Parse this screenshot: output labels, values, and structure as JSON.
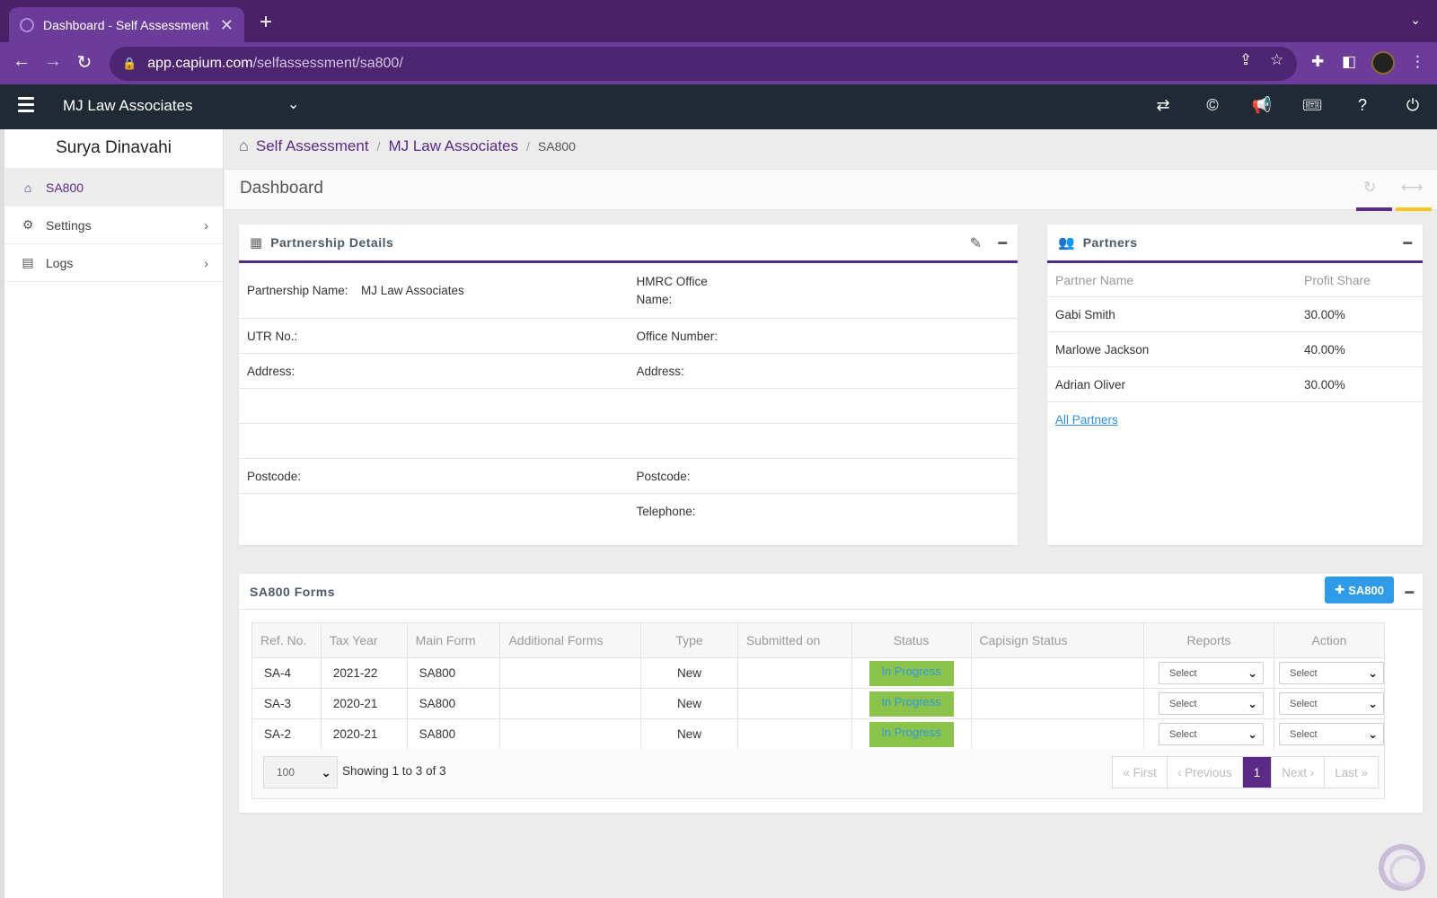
{
  "browser": {
    "tab_title": "Dashboard - Self Assessment",
    "url_host": "app.capium.com",
    "url_path": "/selfassessment/sa800/"
  },
  "header": {
    "client_name": "MJ Law Associates"
  },
  "sidebar": {
    "user_name": "Surya Dinavahi",
    "items": [
      {
        "label": "SA800"
      },
      {
        "label": "Settings"
      },
      {
        "label": "Logs"
      }
    ]
  },
  "breadcrumb": {
    "items": [
      "Self Assessment",
      "MJ Law Associates"
    ],
    "current": "SA800"
  },
  "page": {
    "title": "Dashboard"
  },
  "partnership": {
    "title": "Partnership Details",
    "name_label": "Partnership Name:",
    "name_value": "MJ Law Associates",
    "hmrc_label": "HMRC Office Name:",
    "utr_label": "UTR No.:",
    "office_number_label": "Office Number:",
    "address_label": "Address:",
    "office_address_label": "Address:",
    "postcode_label": "Postcode:",
    "office_postcode_label": "Postcode:",
    "telephone_label": "Telephone:"
  },
  "partners": {
    "title": "Partners",
    "col_name": "Partner Name",
    "col_share": "Profit Share",
    "rows": [
      {
        "name": "Gabi Smith",
        "share": "30.00%"
      },
      {
        "name": "Marlowe Jackson",
        "share": "40.00%"
      },
      {
        "name": "Adrian Oliver",
        "share": "30.00%"
      }
    ],
    "all_link": "All Partners"
  },
  "forms": {
    "title": "SA800 Forms",
    "add_label": "SA800",
    "columns": [
      "Ref. No.",
      "Tax Year",
      "Main Form",
      "Additional Forms",
      "Type",
      "Submitted on",
      "Status",
      "Capisign Status",
      "Reports",
      "Action"
    ],
    "rows": [
      {
        "ref": "SA-4",
        "year": "2021-22",
        "main": "SA800",
        "additional": "",
        "type": "New",
        "submitted": "",
        "status": "In Progress",
        "capisign": "",
        "reports": "Select",
        "action": "Select"
      },
      {
        "ref": "SA-3",
        "year": "2020-21",
        "main": "SA800",
        "additional": "",
        "type": "New",
        "submitted": "",
        "status": "In Progress",
        "capisign": "",
        "reports": "Select",
        "action": "Select"
      },
      {
        "ref": "SA-2",
        "year": "2020-21",
        "main": "SA800",
        "additional": "",
        "type": "New",
        "submitted": "",
        "status": "In Progress",
        "capisign": "",
        "reports": "Select",
        "action": "Select"
      }
    ],
    "page_size": "100",
    "showing": "Showing 1 to 3 of 3",
    "pager": {
      "first": "« First",
      "previous": "‹ Previous",
      "current": "1",
      "next": "Next ›",
      "last": "Last »"
    }
  },
  "colors": {
    "brand_purple": "#5b2a86",
    "header_dark": "#1f2a35",
    "status_green": "#8bc34a",
    "link_blue": "#2f8de4",
    "accent_yellow": "#f5c518"
  }
}
